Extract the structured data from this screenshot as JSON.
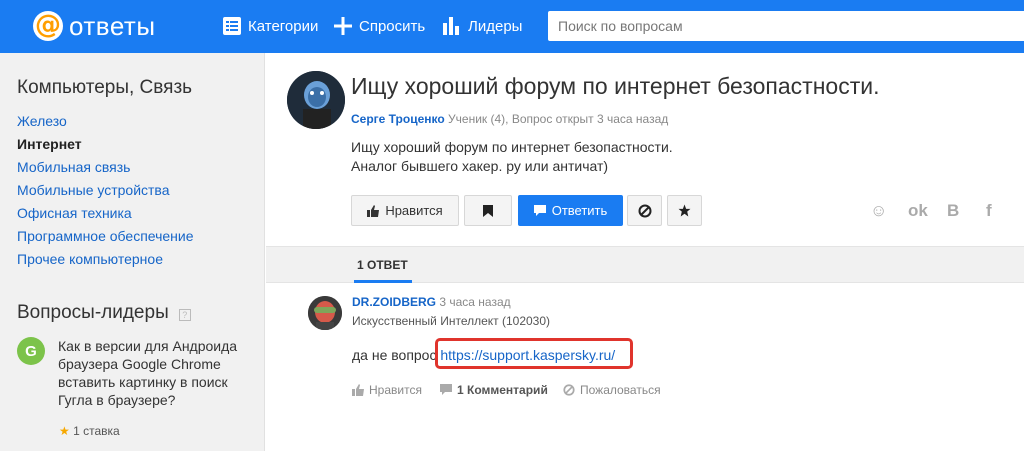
{
  "header": {
    "logo_symbol": "@",
    "logo_text": "ответы",
    "nav": [
      {
        "label": "Категории",
        "icon": "categories-icon"
      },
      {
        "label": "Спросить",
        "icon": "plus-icon"
      },
      {
        "label": "Лидеры",
        "icon": "leaders-icon"
      }
    ],
    "search_placeholder": "Поиск по вопросам",
    "brand_color": "#1a7cf2"
  },
  "sidebar": {
    "category_title": "Компьютеры, Связь",
    "categories": [
      {
        "label": "Железо",
        "active": false
      },
      {
        "label": "Интернет",
        "active": true
      },
      {
        "label": "Мобильная связь",
        "active": false
      },
      {
        "label": "Мобильные устройства",
        "active": false
      },
      {
        "label": "Офисная техника",
        "active": false
      },
      {
        "label": "Программное обеспечение",
        "active": false
      },
      {
        "label": "Прочее компьютерное",
        "active": false
      }
    ],
    "leaders_title": "Вопросы-лидеры",
    "leaders_help": "?",
    "leader": {
      "avatar_letter": "G",
      "text": "Как в версии для Андроида браузера Google Chrome вставить картинку в поиск Гугла в браузере?",
      "rating_star": "★",
      "rating_text": "1 ставка"
    }
  },
  "question": {
    "title": "Ищу хороший форум по интернет безопастности.",
    "author": "Серге Троценко",
    "meta": " Ученик (4), Вопрос открыт 3 часа назад",
    "body_line1": "Ищу хороший форум по интернет безопастности.",
    "body_line2": "Аналог бывшего хакер. ру или античат)",
    "buttons": {
      "like": "Нравится",
      "answer": "Ответить"
    },
    "share": [
      "☺",
      "ok",
      "B",
      "f"
    ]
  },
  "answers": {
    "tab_label": "1 ОТВЕТ",
    "items": [
      {
        "author": "DR.ZOIDBERG",
        "time": " 3 часа назад",
        "rank": "Искусственный Интеллект (102030)",
        "text_prefix": "да не вопрос ",
        "link": "https://support.kaspersky.ru/",
        "like": "Нравится",
        "comments": "1 Комментарий",
        "report": "Пожаловаться"
      }
    ]
  }
}
